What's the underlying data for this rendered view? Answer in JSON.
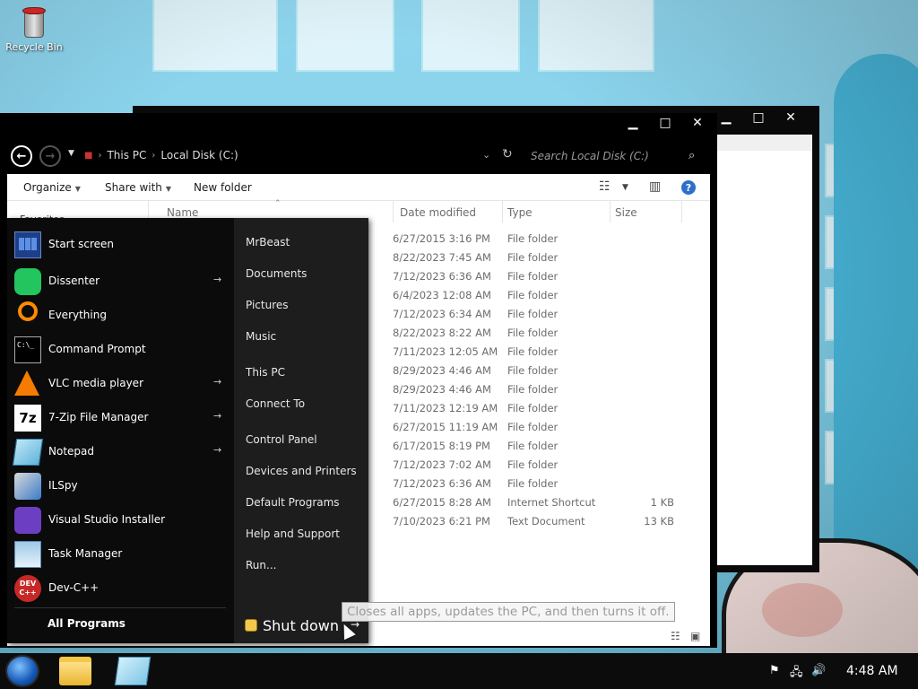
{
  "desktop": {
    "icons": [
      {
        "label": "Recycle Bin",
        "icon": "recycle-bin-icon"
      }
    ]
  },
  "explorer": {
    "breadcrumb": [
      "This PC",
      "Local Disk (C:)"
    ],
    "search_placeholder": "Search Local Disk (C:)",
    "toolbar": {
      "organize": "Organize",
      "share_with": "Share with",
      "new_folder": "New folder"
    },
    "nav_pane_item": "Favorites",
    "columns": {
      "name": "Name",
      "date_modified": "Date modified",
      "type": "Type",
      "size": "Size"
    },
    "rows": [
      {
        "date": "6/27/2015 3:16 PM",
        "type": "File folder",
        "size": ""
      },
      {
        "date": "8/22/2023 7:45 AM",
        "type": "File folder",
        "size": ""
      },
      {
        "date": "7/12/2023 6:36 AM",
        "type": "File folder",
        "size": ""
      },
      {
        "date": "6/4/2023 12:08 AM",
        "type": "File folder",
        "size": ""
      },
      {
        "date": "7/12/2023 6:34 AM",
        "type": "File folder",
        "size": ""
      },
      {
        "date": "8/22/2023 8:22 AM",
        "type": "File folder",
        "size": ""
      },
      {
        "date": "7/11/2023 12:05 AM",
        "type": "File folder",
        "size": ""
      },
      {
        "date": "8/29/2023 4:46 AM",
        "type": "File folder",
        "size": ""
      },
      {
        "date": "8/29/2023 4:46 AM",
        "type": "File folder",
        "size": ""
      },
      {
        "date": "7/11/2023 12:19 AM",
        "type": "File folder",
        "size": ""
      },
      {
        "date": "6/27/2015 11:19 AM",
        "type": "File folder",
        "size": ""
      },
      {
        "date": "6/17/2015 8:19 PM",
        "type": "File folder",
        "size": ""
      },
      {
        "date": "7/12/2023 7:02 AM",
        "type": "File folder",
        "size": ""
      },
      {
        "date": "7/12/2023 6:36 AM",
        "type": "File folder",
        "size": ""
      },
      {
        "date": "6/27/2015 8:28 AM",
        "type": "Internet Shortcut",
        "size": "1 KB"
      },
      {
        "date": "7/10/2023 6:21 PM",
        "type": "Text Document",
        "size": "13 KB"
      }
    ]
  },
  "start_menu": {
    "programs": [
      {
        "label": "Start screen",
        "icon": "start-screen-icon",
        "has_arrow": false
      },
      {
        "label": "Dissenter",
        "icon": "dissenter-icon",
        "has_arrow": true
      },
      {
        "label": "Everything",
        "icon": "everything-search-icon",
        "has_arrow": false
      },
      {
        "label": "Command Prompt",
        "icon": "command-prompt-icon",
        "has_arrow": false
      },
      {
        "label": "VLC media player",
        "icon": "vlc-cone-icon",
        "has_arrow": true
      },
      {
        "label": "7-Zip File Manager",
        "icon": "7zip-icon",
        "has_arrow": true
      },
      {
        "label": "Notepad",
        "icon": "notepad-icon",
        "has_arrow": true
      },
      {
        "label": "ILSpy",
        "icon": "ilspy-icon",
        "has_arrow": false
      },
      {
        "label": "Visual Studio Installer",
        "icon": "visual-studio-installer-icon",
        "has_arrow": false
      },
      {
        "label": "Task Manager",
        "icon": "task-manager-icon",
        "has_arrow": false
      },
      {
        "label": "Dev-C++",
        "icon": "devcpp-icon",
        "has_arrow": false
      }
    ],
    "all_programs": "All Programs",
    "places": [
      "MrBeast",
      "Documents",
      "Pictures",
      "Music",
      "This PC",
      "Connect To",
      "Control Panel",
      "Devices and Printers",
      "Default Programs",
      "Help and Support",
      "Run..."
    ],
    "shutdown_label": "Shut down",
    "devcpp_icon_text": "DEV C++",
    "cmd_icon_text": "C:\\_"
  },
  "tooltip": "Closes all apps, updates the PC, and then turns it off.",
  "taskbar": {
    "clock": "4:48 AM",
    "pinned": [
      "file-explorer-icon",
      "notepad-icon"
    ],
    "tray": [
      "action-center-flag-icon",
      "network-icon",
      "volume-icon"
    ]
  }
}
